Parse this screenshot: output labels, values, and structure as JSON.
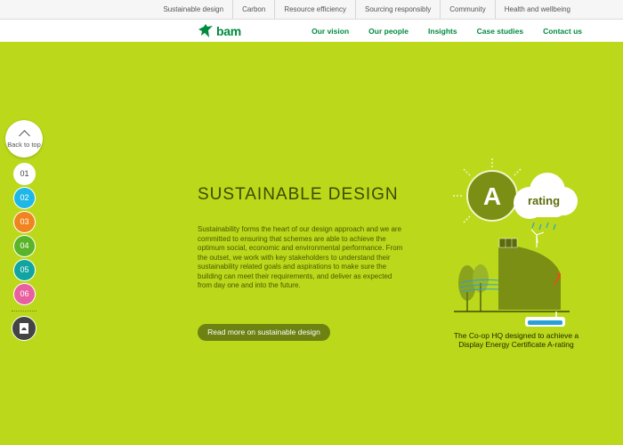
{
  "top_nav": {
    "items": [
      "Sustainable design",
      "Carbon",
      "Resource efficiency",
      "Sourcing responsibly",
      "Community",
      "Health and wellbeing"
    ]
  },
  "header": {
    "logo_text": "bam",
    "nav": [
      "Our vision",
      "Our people",
      "Insights",
      "Case studies",
      "Contact us"
    ]
  },
  "side_nav": {
    "back_to_top": "Back to top",
    "sections": [
      {
        "label": "01",
        "color": "#ffffff"
      },
      {
        "label": "02",
        "color": "#1fb7e6"
      },
      {
        "label": "03",
        "color": "#f0841e"
      },
      {
        "label": "04",
        "color": "#5ab42a"
      },
      {
        "label": "05",
        "color": "#11a4a0"
      },
      {
        "label": "06",
        "color": "#e8609f"
      }
    ],
    "pdf_icon": "pdf-download-icon"
  },
  "content": {
    "title": "SUSTAINABLE DESIGN",
    "body": "Sustainability forms the heart of our design approach and we are committed to ensuring that schemes are able to achieve the optimum social, economic and environmental performance. From the outset, we work with key stakeholders to understand their sustainability related goals and aspirations to make sure the building can meet their requirements, and deliver as expected from day one and into the future.",
    "button": "Read more on sustainable design"
  },
  "illustration": {
    "rating_letter": "A",
    "rating_word": "rating",
    "caption": "The Co-op HQ designed to achieve a Display Energy Certificate A-rating"
  },
  "colors": {
    "background": "#bbd91a",
    "brand_green": "#008a3e",
    "button": "#6d8212",
    "illustration_dark": "#7a8f13"
  }
}
